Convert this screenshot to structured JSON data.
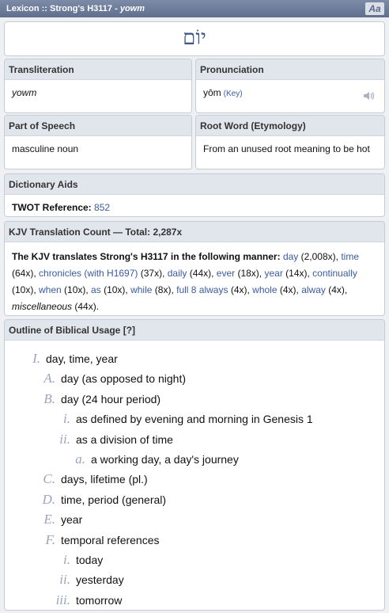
{
  "titlebar": {
    "prefix": "Lexicon :: Strong's H3117 - ",
    "word": "yowm",
    "font_button": "Aa"
  },
  "hebrew": "יוֹם",
  "transliteration": {
    "header": "Transliteration",
    "value": "yowm"
  },
  "pronunciation": {
    "header": "Pronunciation",
    "value": "yōm",
    "key_label": "(Key)"
  },
  "part_of_speech": {
    "header": "Part of Speech",
    "value": "masculine noun"
  },
  "root_word": {
    "header": "Root Word (Etymology)",
    "value": "From an unused root meaning to be hot"
  },
  "dictionary_aids": {
    "header": "Dictionary Aids",
    "label": "TWOT Reference:",
    "value": "852"
  },
  "kjv": {
    "header": "KJV Translation Count — Total: 2,287x",
    "intro": "The KJV translates Strong's H3117 in the following manner:",
    "items": [
      {
        "word": "day",
        "count": " (2,008x), "
      },
      {
        "word": "time",
        "count": " (64x), "
      },
      {
        "word": "chronicles (with H1697)",
        "count": " (37x), "
      },
      {
        "word": "daily",
        "count": " (44x), "
      },
      {
        "word": "ever",
        "count": " (18x), "
      },
      {
        "word": "year",
        "count": " (14x), "
      },
      {
        "word": "continually",
        "count": " (10x), "
      },
      {
        "word": "when",
        "count": " (10x), "
      },
      {
        "word": "as",
        "count": " (10x), "
      },
      {
        "word": "while",
        "count": " (8x), "
      },
      {
        "word": "full 8 always",
        "count": " (4x), "
      },
      {
        "word": "whole",
        "count": " (4x), "
      },
      {
        "word": "alway",
        "count": " (4x), "
      }
    ],
    "misc": "miscellaneous",
    "misc_count": " (44x)."
  },
  "outline": {
    "header": "Outline of Biblical Usage [?]",
    "items": [
      {
        "marker": "I.",
        "text": "day, time, year"
      },
      {
        "marker": "A.",
        "text": "day (as opposed to night)"
      },
      {
        "marker": "B.",
        "text": "day (24 hour period)"
      },
      {
        "marker": "i.",
        "text": "as defined by evening and morning in Genesis 1"
      },
      {
        "marker": "ii.",
        "text": "as a division of time"
      },
      {
        "marker": "a.",
        "text": "a working day, a day's journey"
      },
      {
        "marker": "C.",
        "text": "days, lifetime (pl.)"
      },
      {
        "marker": "D.",
        "text": "time, period (general)"
      },
      {
        "marker": "E.",
        "text": "year"
      },
      {
        "marker": "F.",
        "text": "temporal references"
      },
      {
        "marker": "i.",
        "text": "today"
      },
      {
        "marker": "ii.",
        "text": "yesterday"
      },
      {
        "marker": "iii.",
        "text": "tomorrow"
      }
    ]
  }
}
